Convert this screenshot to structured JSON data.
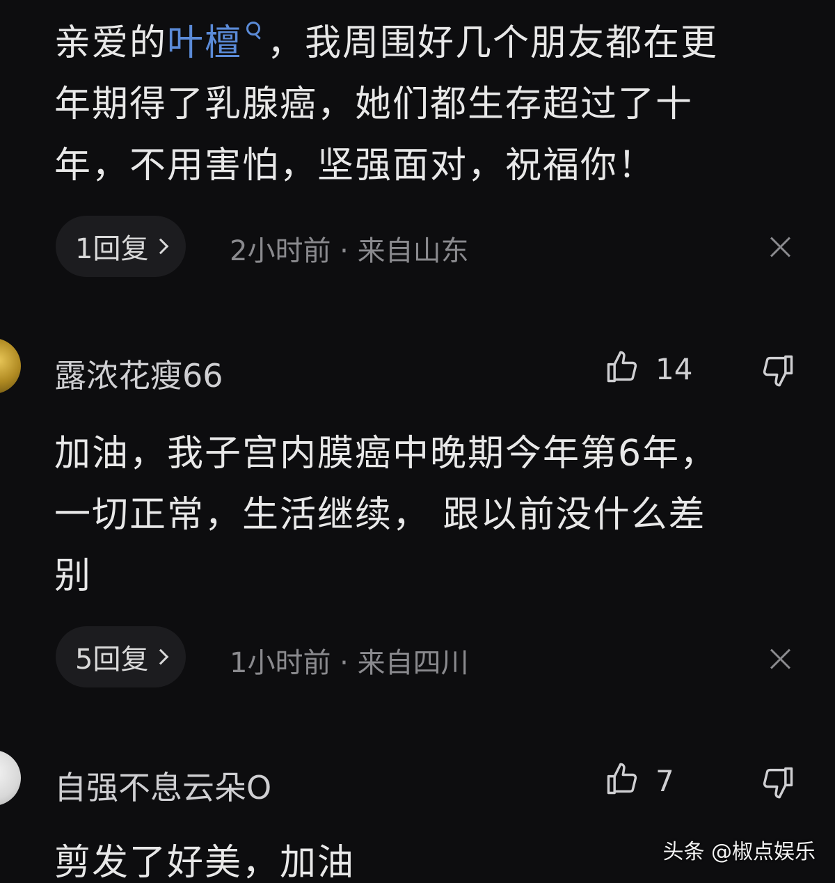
{
  "comment1": {
    "line1_prefix": "亲爱的",
    "mention": "叶檀",
    "line1_suffix": "，我周围好几个朋友都在更",
    "line2": "年期得了乳腺癌，她们都生存超过了十",
    "line3": "年，不用害怕，坚强面对，祝福你！",
    "reply_label": "1回复",
    "meta": "2小时前 · 来自山东"
  },
  "comment2": {
    "username": "露浓花瘦66",
    "likes": "14",
    "line1": "加油，我子宫内膜癌中晚期今年第6年，",
    "line2": "一切正常，生活继续， 跟以前没什么差",
    "line3": "别",
    "reply_label": "5回复",
    "meta": "1小时前 · 来自四川"
  },
  "comment3": {
    "username": "自强不息云朵O",
    "likes": "7",
    "line1": "剪发了好美，加油"
  },
  "watermark": "头条 @椒点娱乐",
  "colors": {
    "background": "#0d0d0f",
    "mention": "#5b8bd8",
    "text": "#e8e8e8",
    "meta": "#8a8a8e",
    "pill": "#1c1c1f"
  }
}
